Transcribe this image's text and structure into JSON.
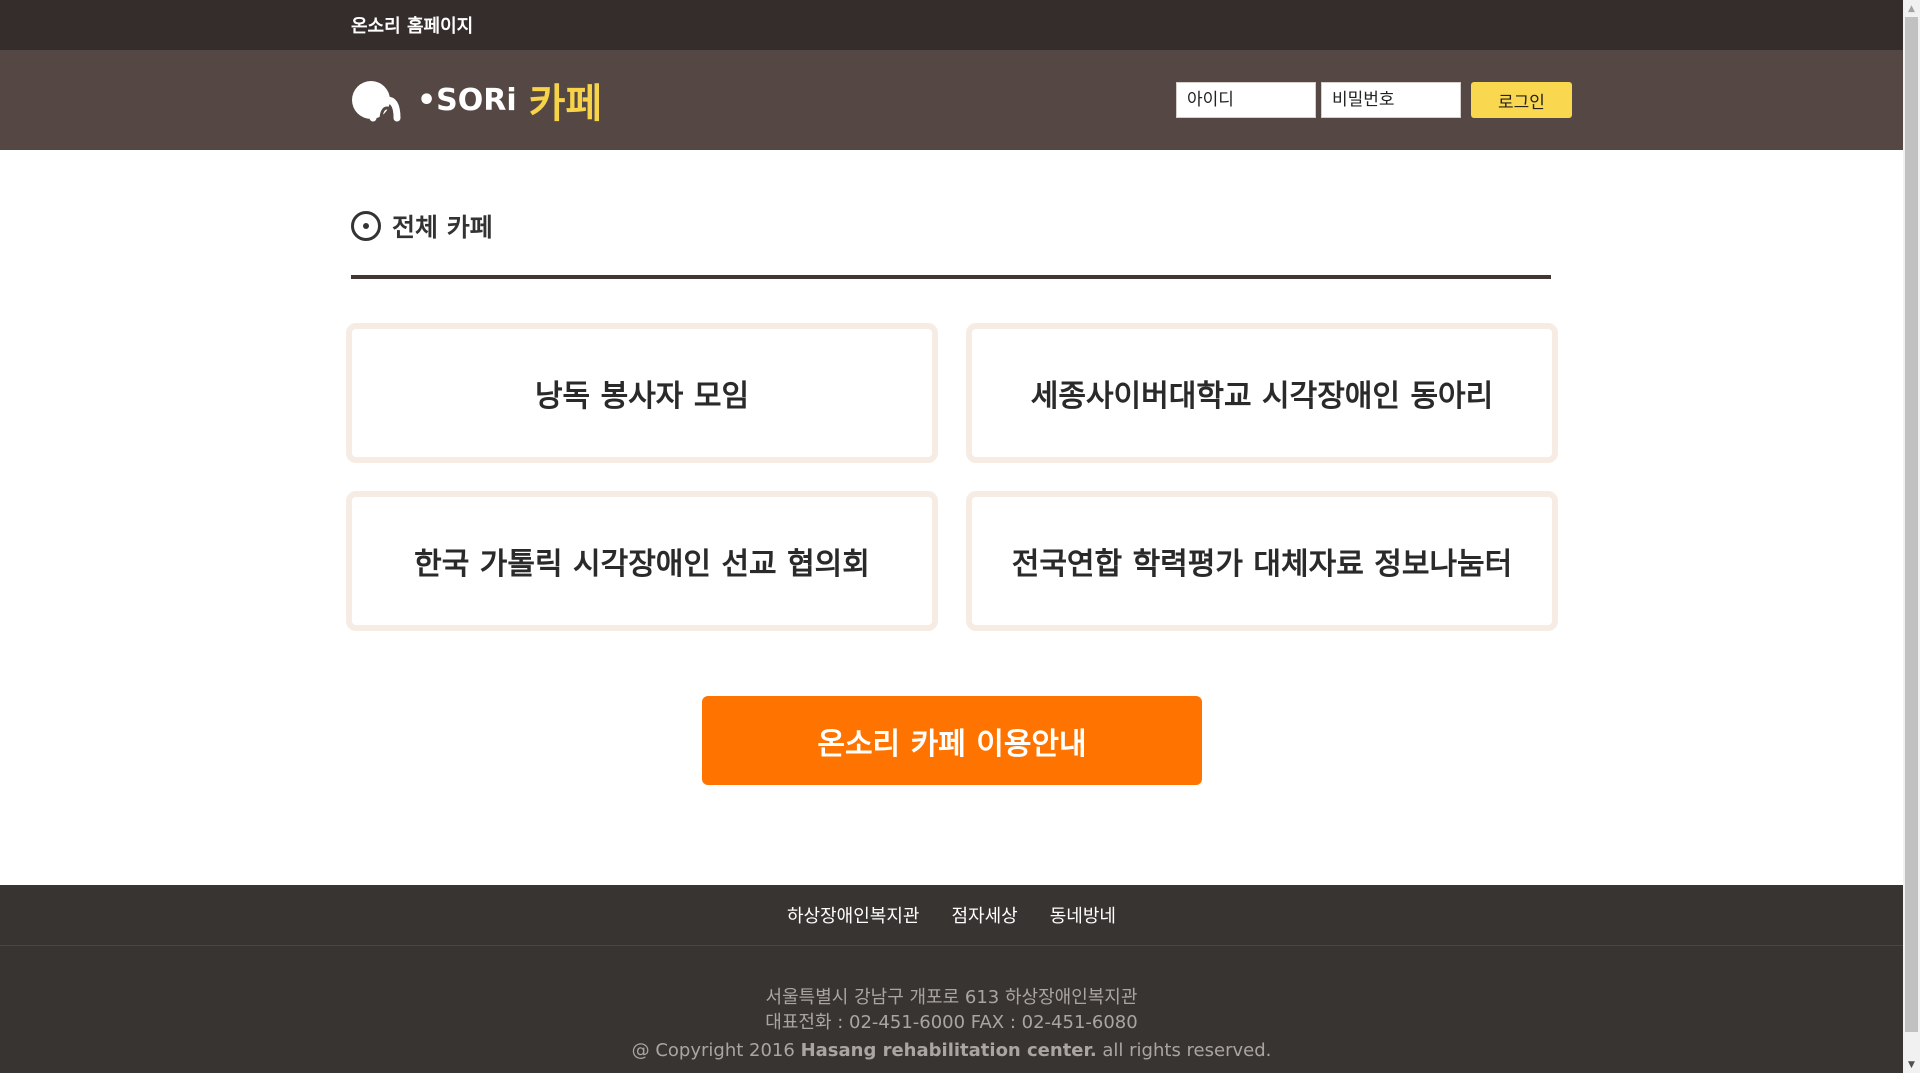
{
  "topbar": {
    "home_link": "온소리 홈페이지"
  },
  "header": {
    "logo_text": "•SORi",
    "logo_cafe": "카페",
    "id_placeholder": "아이디",
    "pw_placeholder": "비밀번호",
    "login_label": "로그인",
    "brand_yellow": "#f6d348"
  },
  "main": {
    "section_title": "전체 카페",
    "cafes": [
      {
        "label": "낭독 봉사자 모임"
      },
      {
        "label": "세종사이버대학교 시각장애인 동아리"
      },
      {
        "label": "한국 가톨릭 시각장애인 선교 협의회"
      },
      {
        "label": "전국연합 학력평가 대체자료 정보나눔터"
      }
    ],
    "guide_button": "온소리 카페 이용안내",
    "accent_orange": "#ff7400"
  },
  "footer": {
    "links": [
      "하상장애인복지관",
      "점자세상",
      "동네방네"
    ],
    "address": "서울특별시 강남구 개포로 613 하상장애인복지관",
    "tel": "대표전화 : 02-451-6000 FAX : 02-451-6080",
    "copy_prefix": "@ Copyright 2016 ",
    "copy_org": "Hasang rehabilitation center.",
    "copy_suffix": " all rights reserved."
  },
  "icons": {
    "logo": "onsori-logo-mark",
    "section": "target-circle-icon",
    "scroll_up": "scroll-up-arrow-icon",
    "scroll_down": "scroll-down-arrow-icon"
  }
}
